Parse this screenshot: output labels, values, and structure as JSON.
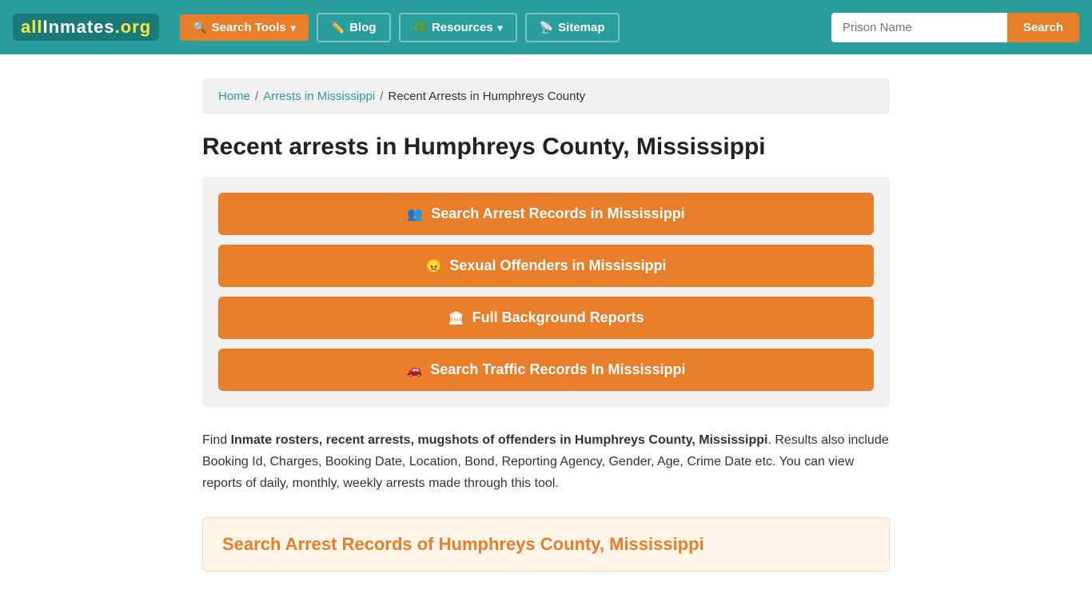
{
  "navbar": {
    "logo": "allinmates.org",
    "search_tools_label": "Search Tools",
    "blog_label": "Blog",
    "resources_label": "Resources",
    "sitemap_label": "Sitemap",
    "search_placeholder": "Prison Name",
    "search_button_label": "Search"
  },
  "breadcrumb": {
    "home": "Home",
    "arrests_ms": "Arrests in Mississippi",
    "current": "Recent Arrests in Humphreys County"
  },
  "page": {
    "title": "Recent arrests in Humphreys County, Mississippi",
    "actions": [
      {
        "id": "search-arrest",
        "icon": "users",
        "label": "Search Arrest Records in Mississippi"
      },
      {
        "id": "sexual-offenders",
        "icon": "offender",
        "label": "Sexual Offenders in Mississippi"
      },
      {
        "id": "background-reports",
        "icon": "building",
        "label": "Full Background Reports"
      },
      {
        "id": "traffic-records",
        "icon": "car",
        "label": "Search Traffic Records In Mississippi"
      }
    ],
    "description_prefix": "Find ",
    "description_bold": "Inmate rosters, recent arrests, mugshots of offenders in Humphreys County, Mississippi",
    "description_suffix": ". Results also include Booking Id, Charges, Booking Date, Location, Bond, Reporting Agency, Gender, Age, Crime Date etc. You can view reports of daily, monthly, weekly arrests made through this tool.",
    "search_records_title": "Search Arrest Records of Humphreys County, Mississippi"
  }
}
